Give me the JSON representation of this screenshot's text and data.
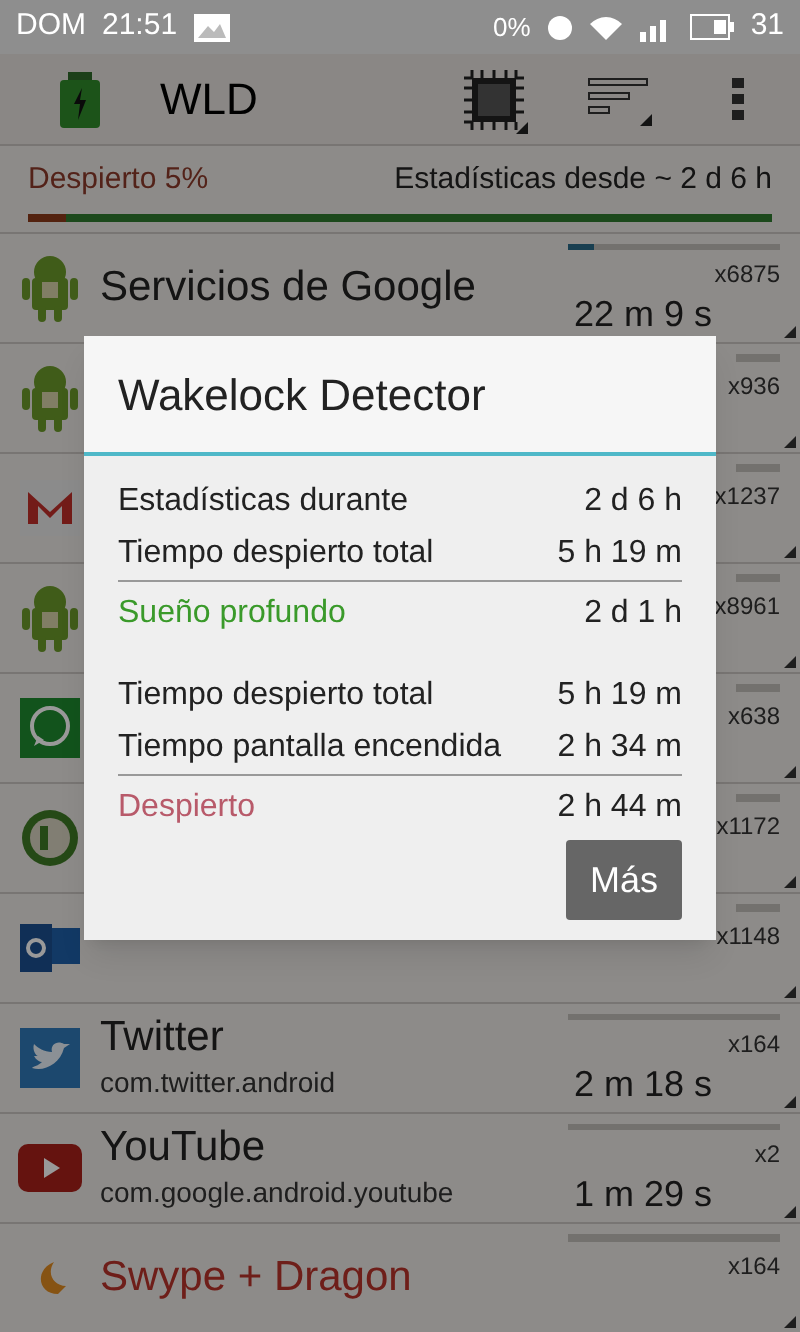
{
  "status_bar": {
    "day": "DOM",
    "time": "21:51",
    "data": "0%",
    "battery": "31"
  },
  "toolbar": {
    "title": "WLD"
  },
  "summary": {
    "awake": "Despierto 5%",
    "since": "Estadísticas desde ~ 2 d 6 h",
    "level": 0.05
  },
  "rows": [
    {
      "name": "Servicios de Google",
      "package": "",
      "count": "x6875",
      "time": "22 m 9 s",
      "level": 0.12,
      "system": false
    },
    {
      "name": "",
      "package": "",
      "count": "x936",
      "time": ""
    },
    {
      "name": "",
      "package": "",
      "count": "x1237",
      "time": ""
    },
    {
      "name": "",
      "package": "",
      "count": "x8961",
      "time": ""
    },
    {
      "name": "",
      "package": "",
      "count": "x638",
      "time": ""
    },
    {
      "name": "",
      "package": "",
      "count": "x1172",
      "time": ""
    },
    {
      "name": "",
      "package": "",
      "count": "x1148",
      "time": ""
    },
    {
      "name": "Twitter",
      "package": "com.twitter.android",
      "count": "x164",
      "time": "2 m 18 s",
      "system": false
    },
    {
      "name": "YouTube",
      "package": "com.google.android.youtube",
      "count": "x2",
      "time": "1 m 29 s",
      "system": false
    },
    {
      "name": "Swype + Dragon",
      "package": "",
      "count": "x164",
      "time": "",
      "system": true
    }
  ],
  "dialog": {
    "title": "Wakelock Detector",
    "sections": [
      {
        "items": [
          {
            "label": "Estadísticas durante",
            "value": "2 d 6 h"
          },
          {
            "label": "Tiempo despierto total",
            "value": "5 h 19 m"
          }
        ],
        "result": {
          "label": "Sueño profundo",
          "value": "2 d 1 h",
          "kind": "deep-sleep"
        }
      },
      {
        "items": [
          {
            "label": "Tiempo despierto total",
            "value": "5 h 19 m"
          },
          {
            "label": "Tiempo pantalla encendida",
            "value": "2 h 34 m"
          }
        ],
        "result": {
          "label": "Despierto",
          "value": "2 h 44 m",
          "kind": "awake"
        }
      }
    ],
    "button": "Más"
  }
}
